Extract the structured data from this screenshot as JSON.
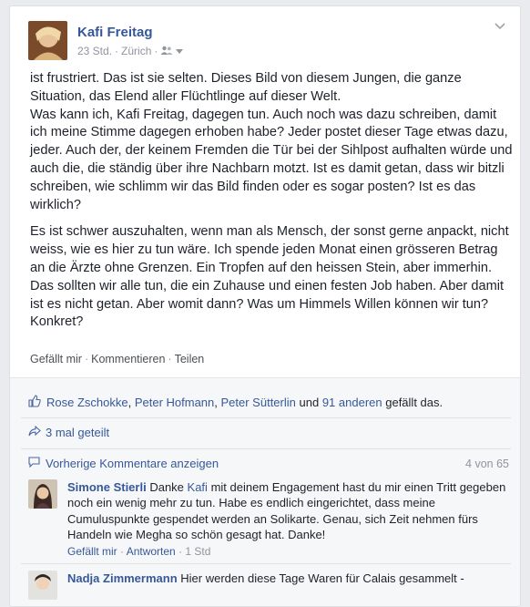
{
  "post": {
    "author": "Kafi Freitag",
    "time": "23 Std.",
    "location": "Zürich",
    "paragraphs": [
      "ist frustriert. Das ist sie selten. Dieses Bild von diesem Jungen, die ganze Situation, das Elend aller Flüchtlinge auf dieser Welt.\nWas kann ich, Kafi Freitag, dagegen tun. Auch noch was dazu schreiben, damit ich meine Stimme dagegen erhoben habe? Jeder postet dieser Tage etwas dazu, jeder. Auch der, der keinem Fremden die Tür bei der Sihlpost aufhalten würde und auch die, die ständig über ihre Nachbarn motzt. Ist es damit getan, dass wir bitzli schreiben, wie schlimm wir das Bild finden oder es sogar posten? Ist es das wirklich?",
      "Es ist schwer auszuhalten, wenn man als Mensch, der sonst gerne anpackt, nicht weiss, wie es hier zu tun wäre. Ich spende jeden Monat einen grösseren Betrag an die Ärzte ohne Grenzen. Ein Tropfen auf den heissen Stein, aber immerhin. Das sollten wir alle tun, die ein Zuhause und einen festen Job haben. Aber damit ist es nicht getan. Aber womit dann? Was um Himmels Willen können wir tun? Konkret?"
    ],
    "actions": {
      "like": "Gefällt mir",
      "comment": "Kommentieren",
      "share": "Teilen"
    }
  },
  "likes": {
    "name1": "Rose Zschokke",
    "name2": "Peter Hofmann",
    "name3": "Peter Sütterlin",
    "joiner": "und",
    "others": "91 anderen",
    "suffix": "gefällt das."
  },
  "shares": {
    "label": "3 mal geteilt"
  },
  "comments_header": {
    "prev_label": "Vorherige Kommentare anzeigen",
    "count": "4 von 65"
  },
  "comments": [
    {
      "name": "Simone Stierli",
      "text_before": "Danke",
      "mention": "Kafi",
      "text_after": "mit deinem Engagement hast du mir einen Tritt gegeben noch ein wenig mehr zu tun. Habe es endlich eingerichtet, dass meine Cumuluspunkte gespendet werden an Solikarte. Genau, sich Zeit nehmen fürs Handeln wie Megha so schön gesagt hat. Danke!",
      "like": "Gefällt mir",
      "reply": "Antworten",
      "time": "1 Std"
    },
    {
      "name": "Nadja Zimmermann",
      "text": "Hier werden diese Tage Waren für Calais gesammelt -"
    }
  ],
  "colors": {
    "link": "#365899",
    "text": "#1d2129",
    "meta": "#90949c"
  }
}
